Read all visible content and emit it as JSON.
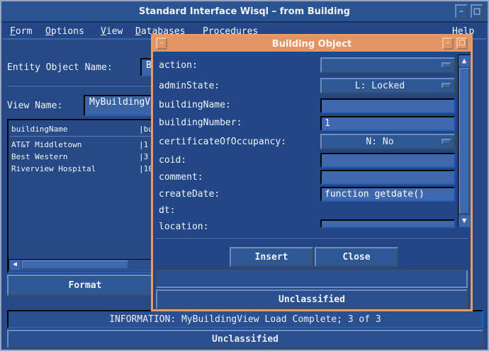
{
  "app": {
    "title": "Standard Interface Wisql – from Building",
    "title_buttons": [
      "–",
      "□"
    ]
  },
  "menubar": {
    "items": [
      {
        "key": "F",
        "rest": "orm"
      },
      {
        "key": "O",
        "rest": "ptions"
      },
      {
        "key": "V",
        "rest": "iew"
      },
      {
        "key": "D",
        "rest": "atabases"
      },
      {
        "key": "P",
        "rest": "rocedures"
      }
    ],
    "help": "Help"
  },
  "entity": {
    "label": "Entity Object Name:",
    "value": "B"
  },
  "view": {
    "label": "View Name:",
    "value": "MyBuildingView"
  },
  "list": {
    "headers": [
      "buildingName",
      "|bu"
    ],
    "rows": [
      {
        "name": "AT&T Middletown",
        "num": "|1"
      },
      {
        "name": "Best Western",
        "num": "|3"
      },
      {
        "name": "Riverview Hospital",
        "num": "|10"
      }
    ]
  },
  "format_button": "Format",
  "status": "INFORMATION: MyBuildingView Load Complete; 3 of 3",
  "bottom": "Unclassified",
  "dialog": {
    "title": "Building Object",
    "fields": [
      {
        "label": "action:",
        "type": "combo",
        "value": ""
      },
      {
        "label": "adminState:",
        "type": "combo",
        "value": "L: Locked"
      },
      {
        "label": "buildingName:",
        "type": "text",
        "value": ""
      },
      {
        "label": "buildingNumber:",
        "type": "text",
        "value": "1"
      },
      {
        "label": "certificateOfOccupancy:",
        "type": "combo",
        "value": "N: No"
      },
      {
        "label": "coid:",
        "type": "text",
        "value": ""
      },
      {
        "label": "comment:",
        "type": "text",
        "value": ""
      },
      {
        "label": "createDate:",
        "type": "text",
        "value": "function getdate()"
      },
      {
        "label": "dt:",
        "type": "none",
        "value": ""
      },
      {
        "label": "location:",
        "type": "text",
        "value": ""
      }
    ],
    "insert": "Insert",
    "close": "Close",
    "classification": "Unclassified"
  },
  "colors": {
    "background": "#254a86",
    "dialog_accent": "#e39364"
  }
}
